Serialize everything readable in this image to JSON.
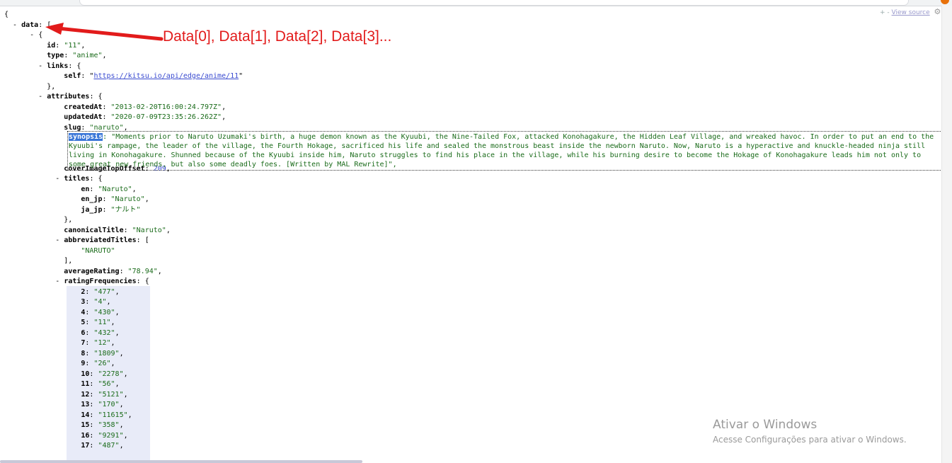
{
  "toolbar": {
    "plus_minus": "+ -",
    "view_source": "View source"
  },
  "json_lines": {
    "open_brace": "{",
    "data_key": "data",
    "data_open": "[",
    "item_open": "{",
    "id_key": "id",
    "id_val": "\"11\"",
    "type_key": "type",
    "type_val": "\"anime\"",
    "links_key": "links",
    "self_key": "self",
    "self_val": "https://kitsu.io/api/edge/anime/11",
    "attributes_key": "attributes",
    "createdAt_key": "createdAt",
    "createdAt_val": "\"2013-02-20T16:00:24.797Z\"",
    "updatedAt_key": "updatedAt",
    "updatedAt_val": "\"2020-07-09T23:35:26.262Z\"",
    "slug_key": "slug",
    "slug_val": "\"naruto\"",
    "synopsis_key": "synopsis",
    "synopsis_val": "\"Moments prior to Naruto Uzumaki's birth, a huge demon known as the Kyuubi, the Nine-Tailed Fox, attacked Konohagakure, the Hidden Leaf Village, and wreaked havoc. In order to put an end to the Kyuubi's rampage, the leader of the village, the Fourth Hokage, sacrificed his life and sealed the monstrous beast inside the newborn Naruto. Now, Naruto is a hyperactive and knuckle-headed ninja still living in Konohagakure. Shunned because of the Kyuubi inside him, Naruto struggles to find his place in the village, while his burning desire to become the Hokage of Konohagakure leads him not only to some great new friends, but also some deadly foes. [Written by MAL Rewrite]\"",
    "coverImageTopOffset_key": "coverImageTopOffset",
    "coverImageTopOffset_val": "209",
    "titles_key": "titles",
    "en_key": "en",
    "en_val": "\"Naruto\"",
    "en_jp_key": "en_jp",
    "en_jp_val": "\"Naruto\"",
    "ja_jp_key": "ja_jp",
    "ja_jp_val": "\"ナルト\"",
    "canonicalTitle_key": "canonicalTitle",
    "canonicalTitle_val": "\"Naruto\"",
    "abbreviatedTitles_key": "abbreviatedTitles",
    "abbreviatedTitles_item": "\"NARUTO\"",
    "averageRating_key": "averageRating",
    "averageRating_val": "\"78.94\"",
    "ratingFrequencies_key": "ratingFrequencies"
  },
  "rating_frequencies": [
    {
      "k": "2",
      "v": "\"477\""
    },
    {
      "k": "3",
      "v": "\"4\""
    },
    {
      "k": "4",
      "v": "\"430\""
    },
    {
      "k": "5",
      "v": "\"11\""
    },
    {
      "k": "6",
      "v": "\"432\""
    },
    {
      "k": "7",
      "v": "\"12\""
    },
    {
      "k": "8",
      "v": "\"1809\""
    },
    {
      "k": "9",
      "v": "\"26\""
    },
    {
      "k": "10",
      "v": "\"2278\""
    },
    {
      "k": "11",
      "v": "\"56\""
    },
    {
      "k": "12",
      "v": "\"5121\""
    },
    {
      "k": "13",
      "v": "\"170\""
    },
    {
      "k": "14",
      "v": "\"11615\""
    },
    {
      "k": "15",
      "v": "\"358\""
    },
    {
      "k": "16",
      "v": "\"9291\""
    },
    {
      "k": "17",
      "v": "\"487\""
    }
  ],
  "annotation": {
    "text": "Data[0], Data[1], Data[2], Data[3]...",
    "color": "#e21b1b"
  },
  "watermark": {
    "title": "Ativar o Windows",
    "subtitle": "Acesse Configurações para ativar o Windows."
  }
}
